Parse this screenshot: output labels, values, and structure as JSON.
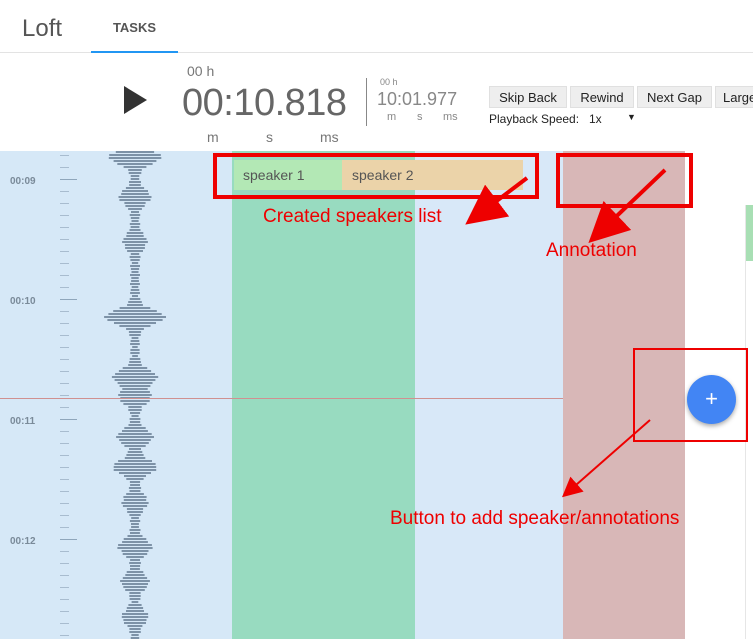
{
  "app": {
    "title": "Loft"
  },
  "tabs": [
    {
      "label": "TASKS",
      "active": true
    }
  ],
  "player": {
    "hours_label": "00 h",
    "current_time": "00:10.818",
    "units": {
      "m": "m",
      "s": "s",
      "ms": "ms"
    },
    "total_hours_label": "00 h",
    "total_time": "10:01.977",
    "buttons": {
      "skip_back": "Skip Back",
      "rewind": "Rewind",
      "next_gap": "Next Gap",
      "large": "Large"
    },
    "playback_speed_label": "Playback Speed:",
    "playback_speed_value": "1x"
  },
  "timeline": {
    "ticks": [
      "00:09",
      "00:10",
      "00:11",
      "00:12"
    ]
  },
  "speakers": [
    "speaker 1",
    "speaker 2"
  ],
  "add_button_label": "+",
  "annotations": {
    "speakers_list": "Created speakers list",
    "annotation": "Annotation",
    "add_button": "Button to add speaker/annotations"
  },
  "colors": {
    "accent": "#2196f3",
    "add_button": "#4285f4",
    "speaker_1": "#b3e8b5",
    "speaker_2": "#ebd3a9",
    "annotation_red": "#ee0000"
  }
}
